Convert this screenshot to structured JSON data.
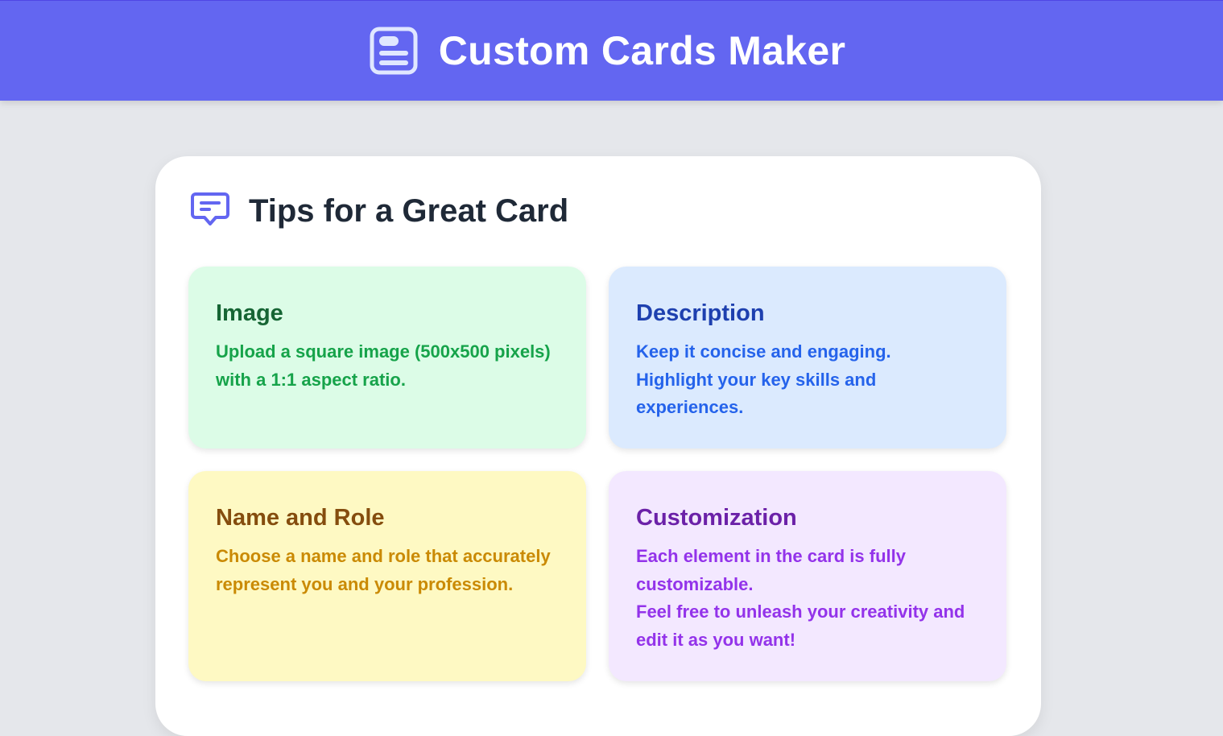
{
  "header": {
    "title": "Custom Cards Maker",
    "icon": "card-layout-icon"
  },
  "tips_panel": {
    "title": "Tips for a Great Card",
    "icon": "chat-bubble-icon",
    "tips": [
      {
        "title": "Image",
        "lines": [
          "Upload a square image (500x500 pixels) with a 1:1 aspect ratio."
        ]
      },
      {
        "title": "Description",
        "lines": [
          "Keep it concise and engaging.",
          "Highlight your key skills and experiences."
        ]
      },
      {
        "title": "Name and Role",
        "lines": [
          "Choose a name and role that accurately represent you and your profession."
        ]
      },
      {
        "title": "Customization",
        "lines": [
          "Each element in the card is fully customizable.",
          "Feel free to unleash your creativity and edit it as you want!"
        ]
      }
    ]
  },
  "colors": {
    "header_bg": "#6366f1",
    "page_bg": "#e5e7eb",
    "image_tip_bg": "#dcfce7",
    "description_tip_bg": "#dbeafe",
    "name_role_tip_bg": "#fef9c3",
    "customization_tip_bg": "#f3e8ff"
  }
}
